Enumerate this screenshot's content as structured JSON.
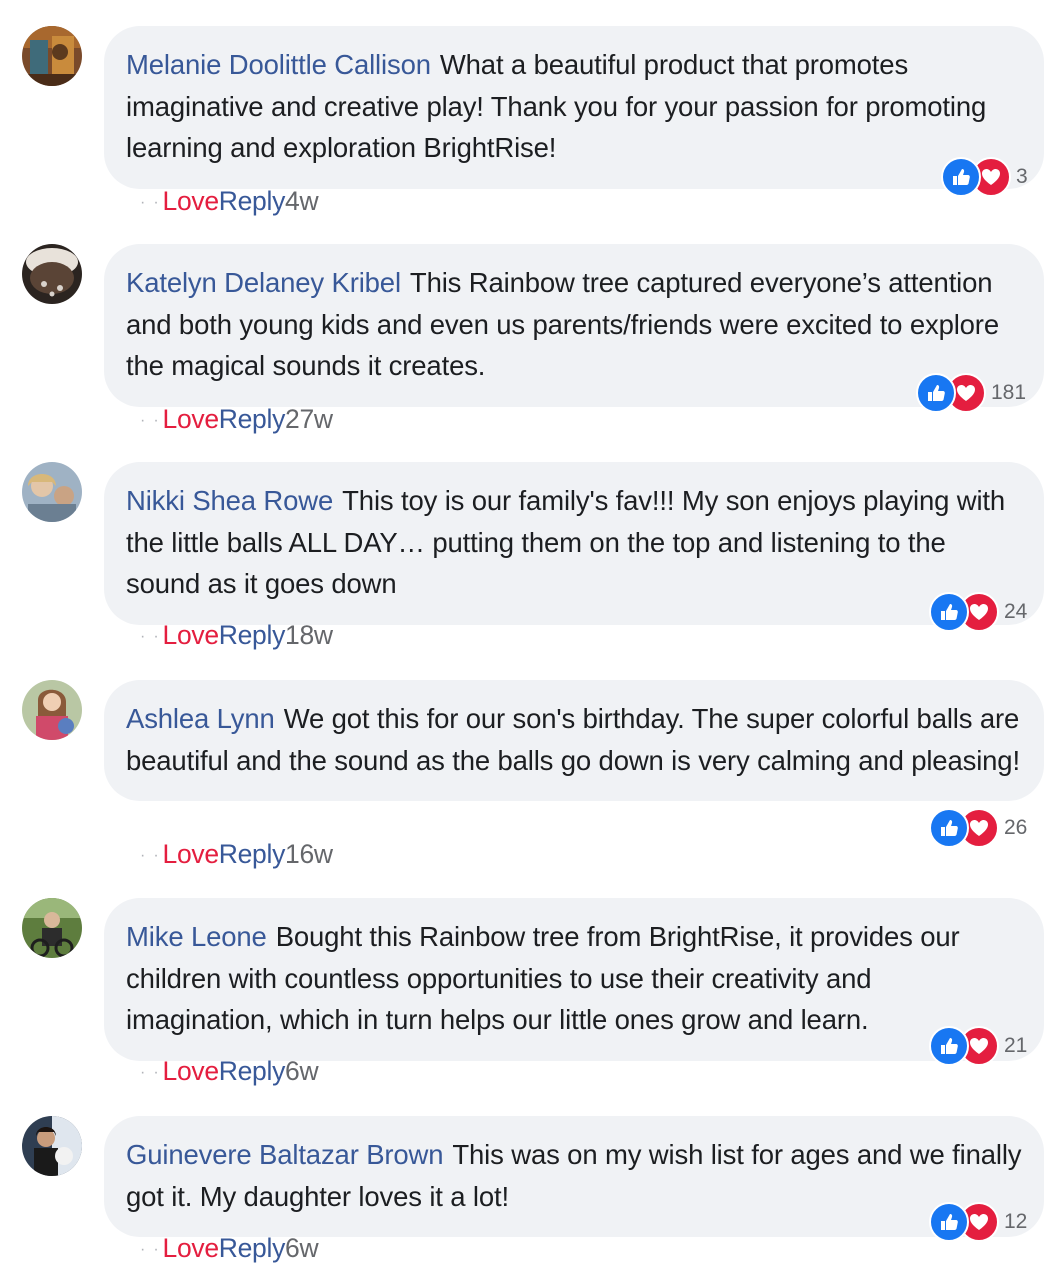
{
  "comments": [
    {
      "author": "Melanie Doolittle Callison",
      "text": "What a beautiful product that promotes imaginative and creative play! Thank you for your passion for promoting learning and exploration BrightRise!",
      "reaction_count": "3",
      "love_label": "Love",
      "reply_label": "Reply",
      "time": "4w"
    },
    {
      "author": "Katelyn Delaney Kribel",
      "text": "This Rainbow tree captured everyone’s attention and both young kids and even us parents/friends were excited to explore the magical sounds it creates.",
      "reaction_count": "181",
      "love_label": "Love",
      "reply_label": "Reply",
      "time": "27w"
    },
    {
      "author": "Nikki Shea Rowe",
      "text": "This toy is our family's fav!!! My son enjoys playing with the little balls ALL DAY… putting them on the top and listening to the sound as it goes down",
      "reaction_count": "24",
      "love_label": "Love",
      "reply_label": "Reply",
      "time": "18w"
    },
    {
      "author": "Ashlea Lynn",
      "text": "We got this for our son's birthday. The super colorful balls are beautiful and the sound as the balls go down is very calming and pleasing!",
      "reaction_count": "26",
      "love_label": "Love",
      "reply_label": "Reply",
      "time": "16w"
    },
    {
      "author": "Mike Leone",
      "text": "Bought this Rainbow tree from BrightRise, it provides our children with countless opportunities to use their creativity and imagination, which in turn helps our little ones grow and learn.",
      "reaction_count": "21",
      "love_label": "Love",
      "reply_label": "Reply",
      "time": "6w"
    },
    {
      "author": "Guinevere Baltazar Brown",
      "text": "This was on my wish list for ages and we finally got it. My daughter loves it a lot!",
      "reaction_count": "12",
      "love_label": "Love",
      "reply_label": "Reply",
      "time": "6w"
    }
  ],
  "icons": {
    "like": "like-thumb-icon",
    "love": "heart-icon"
  },
  "colors": {
    "author_link": "#385898",
    "love": "#e41e3f",
    "like": "#1877f2",
    "bubble_bg": "#f0f2f5",
    "meta": "#65676b"
  }
}
